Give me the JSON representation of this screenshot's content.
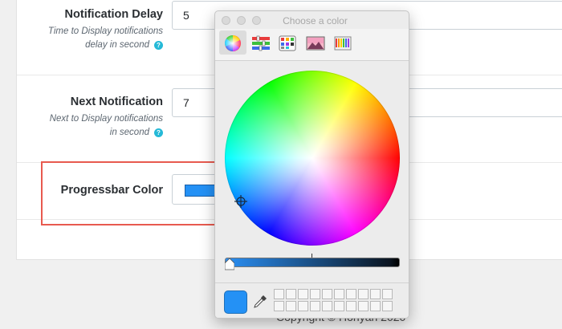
{
  "settings": {
    "notification_delay": {
      "title": "Notification Delay",
      "help_line1": "Time to Display notifications",
      "help_line2": "delay in second",
      "value": "5"
    },
    "next_notification": {
      "title": "Next Notification",
      "help_line1": "Next to Display notifications",
      "help_line2": "in second",
      "value": "7"
    },
    "progressbar_color": {
      "title": "Progressbar Color",
      "value_color": "#2491f5"
    },
    "help_icon_glyph": "?"
  },
  "footer": {
    "text": "Copyright © Honyan 2020"
  },
  "color_picker": {
    "title": "Choose a color",
    "tabs": [
      {
        "name": "color-wheel",
        "selected": true
      },
      {
        "name": "color-sliders",
        "selected": false
      },
      {
        "name": "color-palettes",
        "selected": false
      },
      {
        "name": "image-palettes",
        "selected": false
      },
      {
        "name": "pencils",
        "selected": false
      }
    ],
    "brightness_fraction": 1.0,
    "current_color": "#2491f5",
    "swatch_rows": 2,
    "swatch_cols": 10
  },
  "colors": {
    "accent_highlight": "#e85a4f",
    "help_icon": "#25b9d7"
  }
}
